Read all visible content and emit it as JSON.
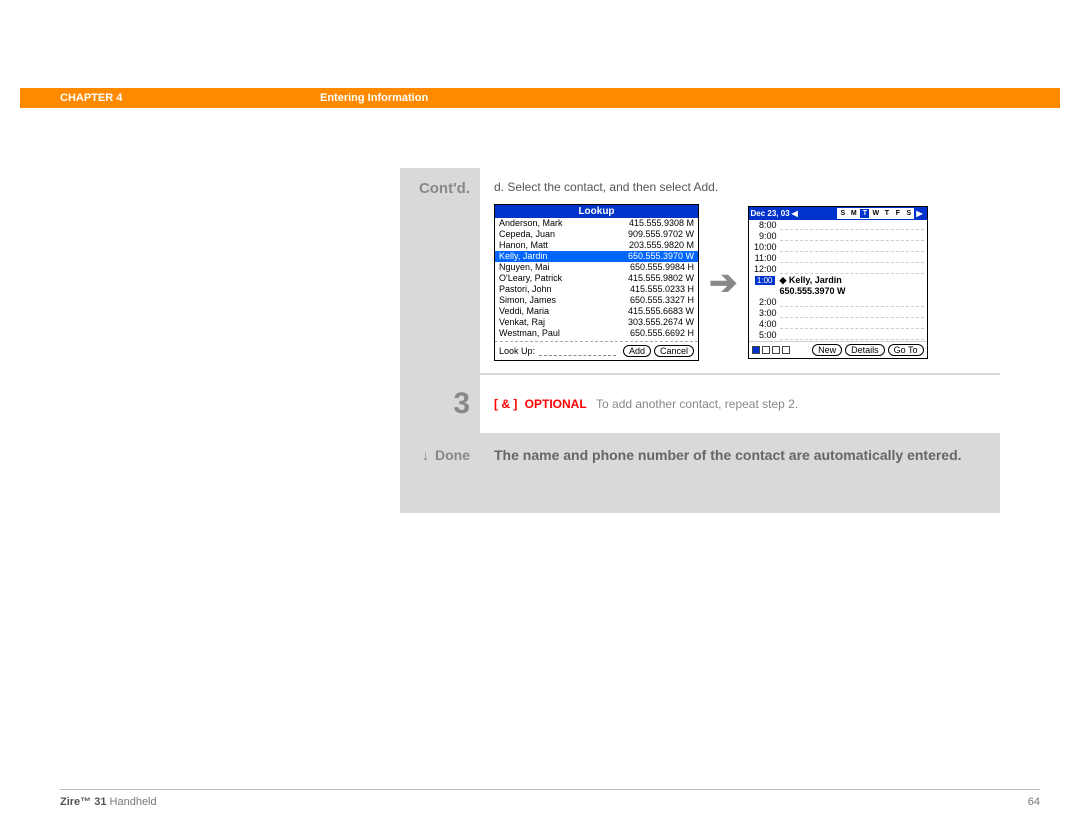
{
  "header": {
    "chapter": "CHAPTER 4",
    "title": "Entering Information"
  },
  "cont": {
    "label": "Cont'd.",
    "instruction": "d.  Select the contact, and then select Add."
  },
  "lookup": {
    "title": "Lookup",
    "contacts": [
      {
        "name": "Anderson, Mark",
        "phone": "415.555.9308 M"
      },
      {
        "name": "Cepeda, Juan",
        "phone": "909.555.9702 W"
      },
      {
        "name": "Hanon, Matt",
        "phone": "203.555.9820 M"
      },
      {
        "name": "Kelly, Jardin",
        "phone": "650.555.3970 W",
        "selected": true
      },
      {
        "name": "Nguyen, Mai",
        "phone": "650.555.9984 H"
      },
      {
        "name": "O'Leary, Patrick",
        "phone": "415.555.9802 W"
      },
      {
        "name": "Pastori, John",
        "phone": "415.555.0233 H"
      },
      {
        "name": "Simon, James",
        "phone": "650.555.3327 H"
      },
      {
        "name": "Veddi, Maria",
        "phone": "415.555.6683 W"
      },
      {
        "name": "Venkat, Raj",
        "phone": "303.555.2674 W"
      },
      {
        "name": "Westman, Paul",
        "phone": "650.555.6692 H"
      }
    ],
    "lookup_label": "Look Up:",
    "add": "Add",
    "cancel": "Cancel"
  },
  "calendar": {
    "date": "Dec 23, 03",
    "days": [
      "S",
      "M",
      "T",
      "W",
      "T",
      "F",
      "S"
    ],
    "active_day_index": 2,
    "times": [
      "8:00",
      "9:00",
      "10:00",
      "11:00",
      "12:00",
      "1:00",
      "2:00",
      "3:00",
      "4:00",
      "5:00"
    ],
    "event_time": "1:00",
    "event_name": "Kelly, Jardin",
    "event_phone": "650.555.3970 W",
    "buttons": {
      "new": "New",
      "details": "Details",
      "goto": "Go To"
    }
  },
  "step3": {
    "num": "3",
    "bracket": "[ & ]",
    "optional": "OPTIONAL",
    "text": "To add another contact, repeat step 2."
  },
  "done": {
    "label": "Done",
    "text": "The name and phone number of the contact are automatically entered."
  },
  "footer": {
    "product_bold": "Zire™ 31",
    "product_rest": " Handheld",
    "page": "64"
  }
}
